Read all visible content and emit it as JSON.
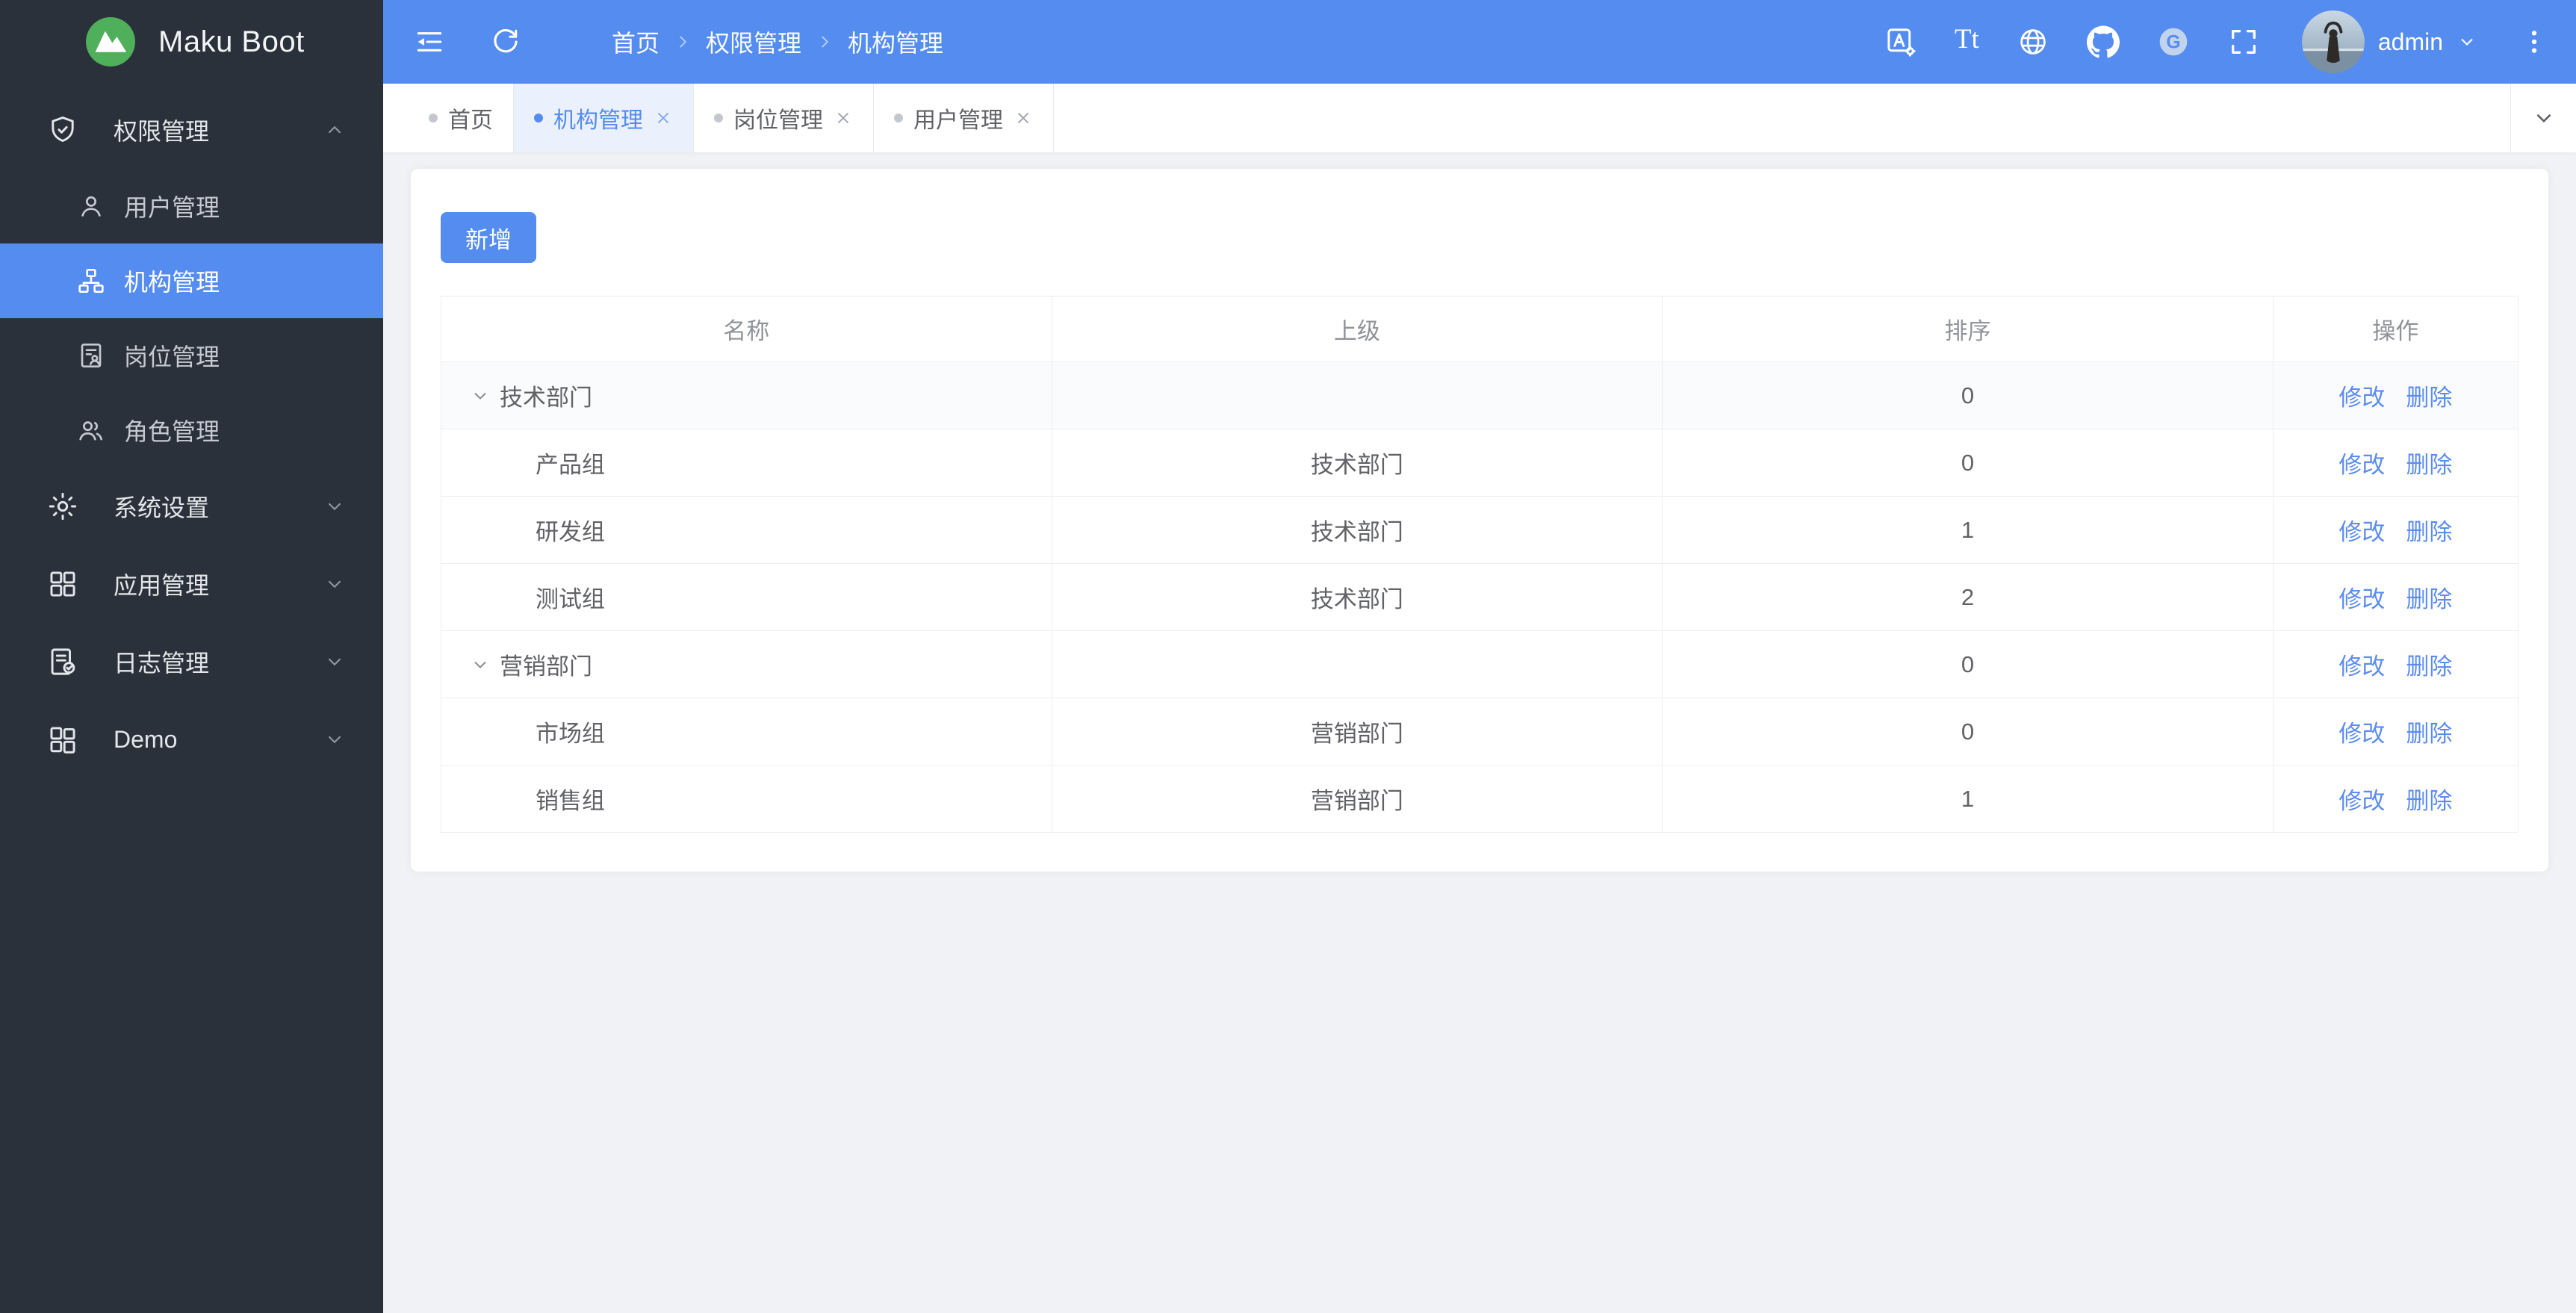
{
  "app": {
    "title": "Maku Boot"
  },
  "colors": {
    "primary": "#548CEF",
    "sidebar_bg": "#2A313A",
    "content_bg": "#F0F2F5",
    "logo_green": "#4FAF5A"
  },
  "sidebar": {
    "items": [
      {
        "id": "permission",
        "label": "权限管理",
        "icon": "shield-check",
        "expanded": true,
        "children": [
          {
            "id": "users",
            "label": "用户管理",
            "icon": "user",
            "active": false
          },
          {
            "id": "org",
            "label": "机构管理",
            "icon": "org-chart",
            "active": true
          },
          {
            "id": "post",
            "label": "岗位管理",
            "icon": "post-doc",
            "active": false
          },
          {
            "id": "role",
            "label": "角色管理",
            "icon": "roles",
            "active": false
          }
        ]
      },
      {
        "id": "system",
        "label": "系统设置",
        "icon": "gear",
        "expanded": false
      },
      {
        "id": "apps",
        "label": "应用管理",
        "icon": "app-grid",
        "expanded": false
      },
      {
        "id": "logs",
        "label": "日志管理",
        "icon": "log-doc",
        "expanded": false
      },
      {
        "id": "demo",
        "label": "Demo",
        "icon": "demo-grid",
        "expanded": false
      }
    ]
  },
  "topbar": {
    "breadcrumb": [
      "首页",
      "权限管理",
      "机构管理"
    ],
    "username": "admin",
    "right_icons": [
      "translate-icon",
      "font-size-icon",
      "globe-icon",
      "github-icon",
      "gitee-icon",
      "fullscreen-icon"
    ],
    "font_size_glyph": "Tt",
    "gitee_glyph": "G"
  },
  "tabs": {
    "items": [
      {
        "label": "首页",
        "closable": false,
        "active": false
      },
      {
        "label": "机构管理",
        "closable": true,
        "active": true
      },
      {
        "label": "岗位管理",
        "closable": true,
        "active": false
      },
      {
        "label": "用户管理",
        "closable": true,
        "active": false
      }
    ]
  },
  "main": {
    "add_button_label": "新增",
    "table": {
      "columns": [
        "名称",
        "上级",
        "排序",
        "操作"
      ],
      "action_labels": [
        "修改",
        "删除"
      ],
      "rows": [
        {
          "name": "技术部门",
          "parent": "",
          "sort": "0",
          "level": 0,
          "expandable": true,
          "highlighted": true
        },
        {
          "name": "产品组",
          "parent": "技术部门",
          "sort": "0",
          "level": 1,
          "expandable": false,
          "highlighted": false
        },
        {
          "name": "研发组",
          "parent": "技术部门",
          "sort": "1",
          "level": 1,
          "expandable": false,
          "highlighted": false
        },
        {
          "name": "测试组",
          "parent": "技术部门",
          "sort": "2",
          "level": 1,
          "expandable": false,
          "highlighted": false
        },
        {
          "name": "营销部门",
          "parent": "",
          "sort": "0",
          "level": 0,
          "expandable": true,
          "highlighted": false
        },
        {
          "name": "市场组",
          "parent": "营销部门",
          "sort": "0",
          "level": 1,
          "expandable": false,
          "highlighted": false
        },
        {
          "name": "销售组",
          "parent": "营销部门",
          "sort": "1",
          "level": 1,
          "expandable": false,
          "highlighted": false
        }
      ]
    }
  }
}
